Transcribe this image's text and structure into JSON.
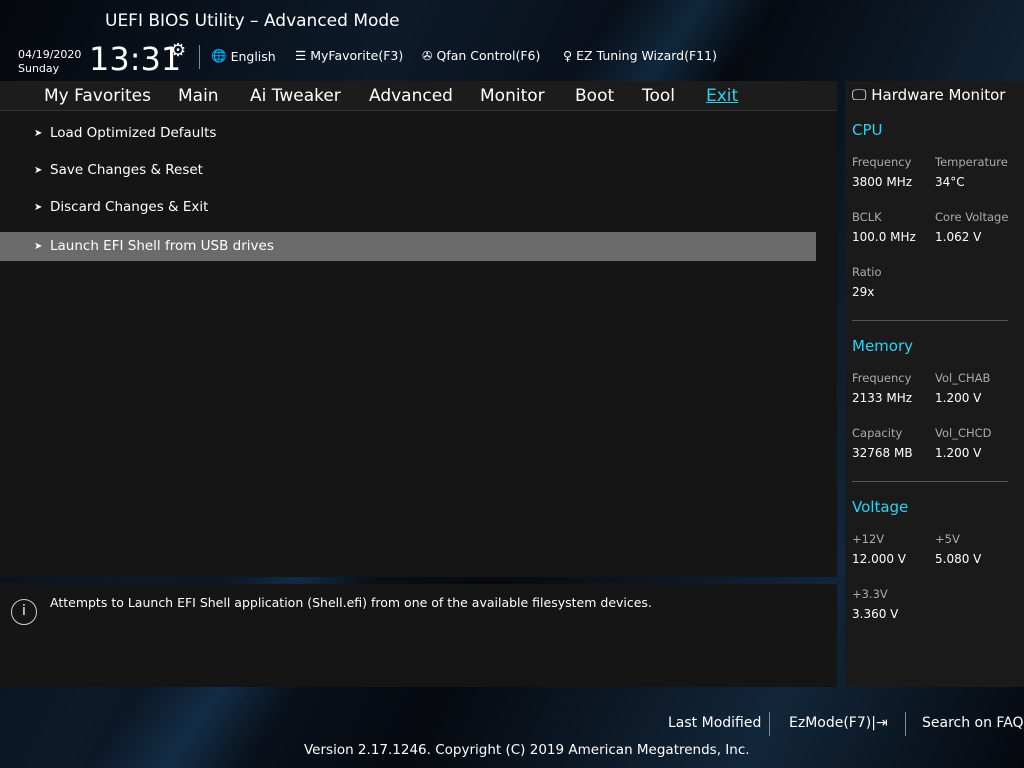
{
  "title": "UEFI BIOS Utility – Advanced Mode",
  "date": "04/19/2020",
  "day": "Sunday",
  "time": "13:31",
  "toolbar": {
    "language": "English",
    "favorite": "MyFavorite(F3)",
    "qfan": "Qfan Control(F6)",
    "ez_tuning": "EZ Tuning Wizard(F11)"
  },
  "tabs": [
    "My Favorites",
    "Main",
    "Ai Tweaker",
    "Advanced",
    "Monitor",
    "Boot",
    "Tool",
    "Exit"
  ],
  "items": [
    "Load Optimized Defaults",
    "Save Changes & Reset",
    "Discard Changes & Exit",
    "Launch EFI Shell from USB drives"
  ],
  "help": "Attempts to Launch EFI Shell application (Shell.efi) from one of the available filesystem devices.",
  "hw": {
    "title": "Hardware Monitor",
    "cpu": {
      "title": "CPU",
      "freq_l": "Frequency",
      "freq": "3800 MHz",
      "temp_l": "Temperature",
      "temp": "34°C",
      "bclk_l": "BCLK",
      "bclk": "100.0 MHz",
      "cv_l": "Core Voltage",
      "cv": "1.062 V",
      "ratio_l": "Ratio",
      "ratio": "29x"
    },
    "mem": {
      "title": "Memory",
      "freq_l": "Frequency",
      "freq": "2133 MHz",
      "ab_l": "Vol_CHAB",
      "ab": "1.200 V",
      "cap_l": "Capacity",
      "cap": "32768 MB",
      "cd_l": "Vol_CHCD",
      "cd": "1.200 V"
    },
    "volt": {
      "title": "Voltage",
      "v12_l": "+12V",
      "v12": "12.000 V",
      "v5_l": "+5V",
      "v5": "5.080 V",
      "v33_l": "+3.3V",
      "v33": "3.360 V"
    }
  },
  "footer": {
    "last_modified": "Last Modified",
    "ezmode": "EzMode(F7)",
    "faq": "Search on FAQ",
    "version": "Version 2.17.1246. Copyright (C) 2019 American Megatrends, Inc."
  },
  "colors": {
    "accent": "#2fd0f0",
    "selected": "#6b6b6b"
  }
}
